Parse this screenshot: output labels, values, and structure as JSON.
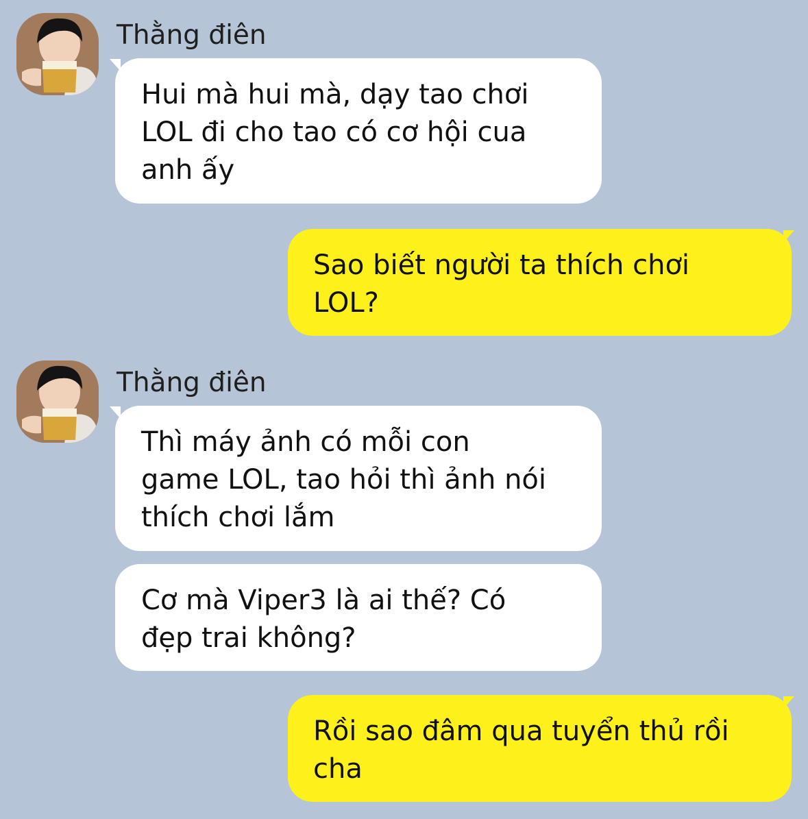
{
  "conversation": {
    "contact_name": "Thằng điên",
    "messages": [
      {
        "from": "contact",
        "text": "Hui mà hui mà, dạy tao chơi\nLOL đi cho tao có cơ hội cua\nanh ấy"
      },
      {
        "from": "me",
        "text": "Sao biết người ta thích chơi\nLOL?"
      },
      {
        "from": "contact",
        "text": "Thì máy ảnh có mỗi con\ngame LOL, tao hỏi thì ảnh nói\nthích chơi lắm"
      },
      {
        "from": "contact",
        "text": "Cơ mà Viper3 là ai thế? Có\nđẹp trai không?"
      },
      {
        "from": "me",
        "text": "Rồi sao đâm qua tuyển thủ rồi\ncha"
      }
    ]
  },
  "colors": {
    "background": "#b5c5d7",
    "incoming_bubble": "#ffffff",
    "outgoing_bubble": "#fef01b"
  },
  "icons": {
    "avatar": "profile-photo"
  }
}
